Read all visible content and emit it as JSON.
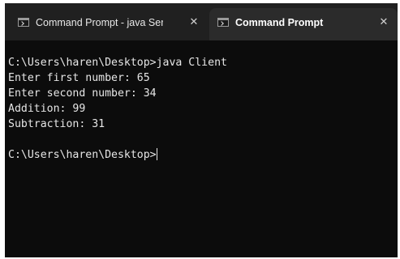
{
  "tabs": [
    {
      "title": "Command Prompt - java  Server",
      "icon": "terminal-icon",
      "close": "✕",
      "active": false
    },
    {
      "title": "Command Prompt",
      "icon": "terminal-icon",
      "close": "✕",
      "active": true
    }
  ],
  "terminal": {
    "lines": [
      "C:\\Users\\haren\\Desktop>java Client",
      "Enter first number: 65",
      "Enter second number: 34",
      "Addition: 99",
      "Subtraction: 31",
      "",
      "C:\\Users\\haren\\Desktop>"
    ]
  },
  "colors": {
    "background": "#0c0c0c",
    "tabbar": "#202020",
    "active_tab": "#2b2b2b",
    "text": "#e6e6e6"
  }
}
